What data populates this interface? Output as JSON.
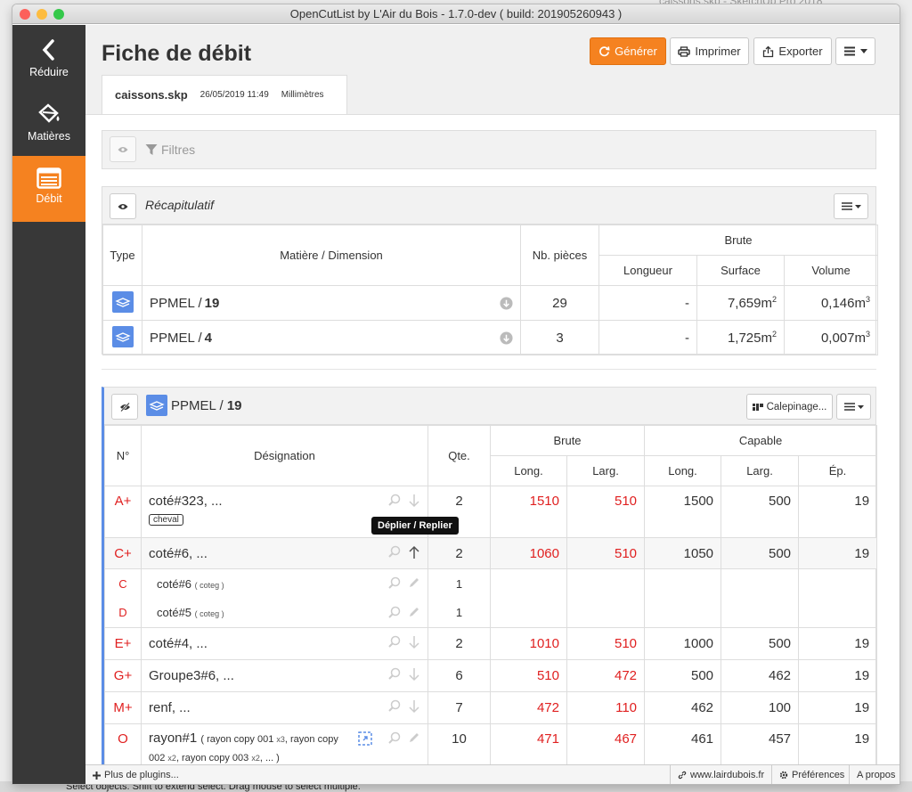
{
  "window": {
    "title": "OpenCutList by L'Air du Bois - 1.7.0-dev ( build: 201905260943 )"
  },
  "background": {
    "title": "caissons.skp - SketchUp Pro 2018",
    "status": "Select objects. Shift to extend select. Drag mouse to select multiple."
  },
  "colors": {
    "accent": "#f58220",
    "sidebar": "#383838",
    "material_icon": "#5b8de6",
    "red_value": "#e02020"
  },
  "sidebar": {
    "items": [
      {
        "label": "Réduire",
        "icon": "chevron-left-icon"
      },
      {
        "label": "Matières",
        "icon": "paint-bucket-icon"
      },
      {
        "label": "Débit",
        "icon": "list-icon",
        "active": true
      }
    ]
  },
  "header": {
    "title": "Fiche de débit",
    "buttons": {
      "generate": "Générer",
      "print": "Imprimer",
      "export": "Exporter"
    }
  },
  "file_tab": {
    "name": "caissons.skp",
    "date": "26/05/2019 11:49",
    "unit": "Millimètres"
  },
  "filters": {
    "label": "Filtres"
  },
  "summary": {
    "title": "Récapitulatif",
    "headers": {
      "type": "Type",
      "material": "Matière / Dimension",
      "count": "Nb. pièces",
      "raw": "Brute",
      "length": "Longueur",
      "surface": "Surface",
      "volume": "Volume"
    },
    "rows": [
      {
        "material": "PPMEL / ",
        "dim": "19",
        "count": "29",
        "length": "-",
        "surface": "7,659m",
        "volume": "0,146m"
      },
      {
        "material": "PPMEL / ",
        "dim": "4",
        "count": "3",
        "length": "-",
        "surface": "1,725m",
        "volume": "0,007m"
      }
    ]
  },
  "group": {
    "material": "PPMEL / ",
    "dim": "19",
    "calepinage": "Calepinage...",
    "headers": {
      "num": "N°",
      "designation": "Désignation",
      "qty": "Qte.",
      "raw": "Brute",
      "capable": "Capable",
      "long": "Long.",
      "larg": "Larg.",
      "ep": "Ép."
    },
    "tooltip": "Déplier / Replier",
    "rows": [
      {
        "num": "A+",
        "name": "coté#323, ...",
        "badge": "cheval",
        "qty": "2",
        "raw_long": "1510",
        "raw_larg": "510",
        "cap_long": "1500",
        "cap_larg": "500",
        "ep": "19"
      },
      {
        "num": "C+",
        "name": "coté#6, ...",
        "qty": "2",
        "raw_long": "1060",
        "raw_larg": "510",
        "cap_long": "1050",
        "cap_larg": "500",
        "ep": "19"
      },
      {
        "num": "C",
        "name": "coté#6",
        "tag": "( coteg )",
        "qty": "1"
      },
      {
        "num": "D",
        "name": "coté#5",
        "tag": "( coteg )",
        "qty": "1"
      },
      {
        "num": "E+",
        "name": "coté#4, ...",
        "qty": "2",
        "raw_long": "1010",
        "raw_larg": "510",
        "cap_long": "1000",
        "cap_larg": "500",
        "ep": "19"
      },
      {
        "num": "G+",
        "name": "Groupe3#6, ...",
        "qty": "6",
        "raw_long": "510",
        "raw_larg": "472",
        "cap_long": "500",
        "cap_larg": "462",
        "ep": "19"
      },
      {
        "num": "M+",
        "name": "renf, ...",
        "qty": "7",
        "raw_long": "472",
        "raw_larg": "110",
        "cap_long": "462",
        "cap_larg": "100",
        "ep": "19"
      },
      {
        "num": "O",
        "name": "rayon#1",
        "tag1": "( rayon copy 001 ",
        "x1": "x3",
        "tag2": ", rayon copy 002 ",
        "x2": "x2",
        "tag3": ", rayon copy 003 ",
        "x3": "x2",
        "tag4": ", ... )",
        "qty": "10",
        "raw_long": "471",
        "raw_larg": "467",
        "cap_long": "461",
        "cap_larg": "457",
        "ep": "19"
      }
    ]
  },
  "footer": {
    "plugins": "Plus de plugins...",
    "website": "www.lairdubois.fr",
    "prefs": "Préférences",
    "about": "A propos"
  }
}
